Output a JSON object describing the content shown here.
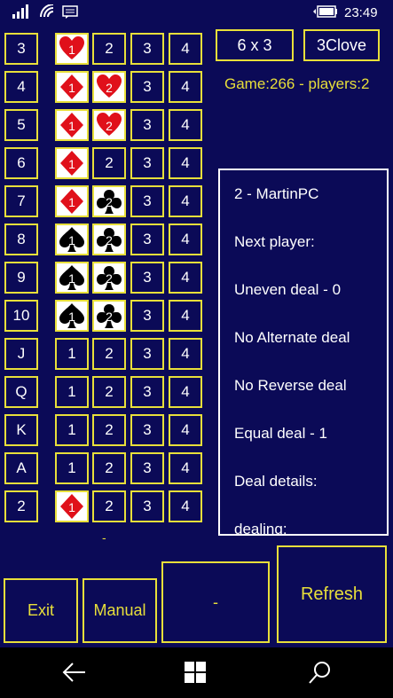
{
  "status": {
    "time": "23:49"
  },
  "header": {
    "size_button": "6 x 3",
    "player_button": "3Clove",
    "game_info": "Game:266 - players:2"
  },
  "rows": [
    {
      "rank": "3",
      "cols": [
        {
          "v": "1",
          "suit": "heart"
        },
        {
          "v": "2"
        },
        {
          "v": "3"
        },
        {
          "v": "4"
        }
      ]
    },
    {
      "rank": "4",
      "cols": [
        {
          "v": "1",
          "suit": "diamond"
        },
        {
          "v": "2",
          "suit": "heart"
        },
        {
          "v": "3"
        },
        {
          "v": "4"
        }
      ]
    },
    {
      "rank": "5",
      "cols": [
        {
          "v": "1",
          "suit": "diamond"
        },
        {
          "v": "2",
          "suit": "heart"
        },
        {
          "v": "3"
        },
        {
          "v": "4"
        }
      ]
    },
    {
      "rank": "6",
      "cols": [
        {
          "v": "1",
          "suit": "diamond"
        },
        {
          "v": "2"
        },
        {
          "v": "3"
        },
        {
          "v": "4"
        }
      ]
    },
    {
      "rank": "7",
      "cols": [
        {
          "v": "1",
          "suit": "diamond"
        },
        {
          "v": "2",
          "suit": "club"
        },
        {
          "v": "3"
        },
        {
          "v": "4"
        }
      ]
    },
    {
      "rank": "8",
      "cols": [
        {
          "v": "1",
          "suit": "spade"
        },
        {
          "v": "2",
          "suit": "club"
        },
        {
          "v": "3"
        },
        {
          "v": "4"
        }
      ]
    },
    {
      "rank": "9",
      "cols": [
        {
          "v": "1",
          "suit": "spade"
        },
        {
          "v": "2",
          "suit": "club"
        },
        {
          "v": "3"
        },
        {
          "v": "4"
        }
      ]
    },
    {
      "rank": "10",
      "cols": [
        {
          "v": "1",
          "suit": "spade"
        },
        {
          "v": "2",
          "suit": "club"
        },
        {
          "v": "3"
        },
        {
          "v": "4"
        }
      ]
    },
    {
      "rank": "J",
      "cols": [
        {
          "v": "1"
        },
        {
          "v": "2"
        },
        {
          "v": "3"
        },
        {
          "v": "4"
        }
      ]
    },
    {
      "rank": "Q",
      "cols": [
        {
          "v": "1"
        },
        {
          "v": "2"
        },
        {
          "v": "3"
        },
        {
          "v": "4"
        }
      ]
    },
    {
      "rank": "K",
      "cols": [
        {
          "v": "1"
        },
        {
          "v": "2"
        },
        {
          "v": "3"
        },
        {
          "v": "4"
        }
      ]
    },
    {
      "rank": "A",
      "cols": [
        {
          "v": "1"
        },
        {
          "v": "2"
        },
        {
          "v": "3"
        },
        {
          "v": "4"
        }
      ]
    },
    {
      "rank": "2",
      "cols": [
        {
          "v": "1",
          "suit": "diamond"
        },
        {
          "v": "2"
        },
        {
          "v": "3"
        },
        {
          "v": "4"
        }
      ]
    }
  ],
  "panel": {
    "lines": [
      "2 - MartinPC",
      "Next player:",
      "Uneven deal - 0",
      "No Alternate deal",
      "No Reverse deal",
      "Equal deal - 1",
      "Deal details:",
      "dealing:"
    ]
  },
  "small_dash": "-",
  "buttons": {
    "exit": "Exit",
    "manual": "Manual",
    "middle": "-",
    "refresh": "Refresh"
  },
  "colors": {
    "background": "#0b0a57",
    "accent": "#e8df3a",
    "red_suit": "#e0101a",
    "black_suit": "#000000"
  }
}
